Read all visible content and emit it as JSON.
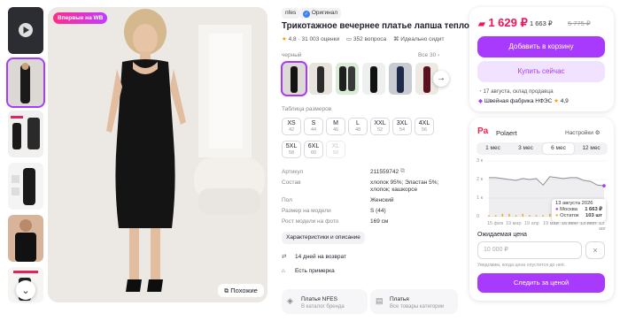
{
  "gallery": {
    "badge": "Впервые на WB",
    "similar_label": "Похожие"
  },
  "product": {
    "brand": "nfes",
    "original_label": "Оригинал",
    "title": "Трикотажное вечернее платье лапша теплое",
    "rating": "4,8",
    "reviews": "31 003 оценки",
    "questions": "352 вопроса",
    "fit_label": "Идеально сидит",
    "color_label": "черный",
    "colors_all": "Все 30",
    "size_table_label": "Таблица размеров",
    "sizes": [
      {
        "s": "XS",
        "n": "42",
        "disabled": false
      },
      {
        "s": "S",
        "n": "44",
        "disabled": false
      },
      {
        "s": "M",
        "n": "46",
        "disabled": false
      },
      {
        "s": "L",
        "n": "48",
        "disabled": false
      },
      {
        "s": "XXL",
        "n": "52",
        "disabled": false
      },
      {
        "s": "3XL",
        "n": "54",
        "disabled": false
      },
      {
        "s": "4XL",
        "n": "56",
        "disabled": false
      },
      {
        "s": "5XL",
        "n": "58",
        "disabled": false
      },
      {
        "s": "6XL",
        "n": "60",
        "disabled": false
      },
      {
        "s": "XL",
        "n": "50",
        "disabled": true
      }
    ],
    "specs": [
      {
        "k": "Артикул",
        "v": "211559742"
      },
      {
        "k": "Состав",
        "v": "хлопок 95%; Эластан 5%;"
      },
      {
        "k": "",
        "v": "хлопок; кашкорсе"
      },
      {
        "k": "Пол",
        "v": "Женский"
      },
      {
        "k": "Размер на модели",
        "v": "S (44)"
      },
      {
        "k": "Рост модели на фото",
        "v": "169 см"
      }
    ],
    "description_button": "Характеристики и описание",
    "services": [
      {
        "icon": "return-icon",
        "label": "14 дней на возврат"
      },
      {
        "icon": "hanger-icon",
        "label": "Есть примерка"
      }
    ],
    "footer_cards": [
      {
        "title": "Платья NFES",
        "subtitle": "В каталог бренда"
      },
      {
        "title": "Платья",
        "subtitle": "Все товары категории"
      }
    ]
  },
  "buy": {
    "price": "1 629 ₽",
    "price_wallet": "1 663 ₽",
    "price_old": "5 775 ₽",
    "cart_button": "Добавить в корзину",
    "buy_button": "Купить сейчас",
    "delivery": "17 августа, склад продавца",
    "seller": "Швейная фабрика НФЭС",
    "seller_rating": "4,9",
    "accent": "#a73afd",
    "price_color": "#f91155"
  },
  "polaert": {
    "logo": "Pa",
    "name": "Polaert",
    "settings": "Настройки",
    "tabs": [
      "1 мес",
      "3 мес",
      "6 мес",
      "12 мес"
    ],
    "active_tab": 2,
    "tooltip": {
      "date": "13 августа 2026",
      "rows": [
        {
          "k": "Москва",
          "v": "1 663 ₽"
        },
        {
          "k": "Остаток",
          "v": "103 шт"
        }
      ]
    },
    "expected_label": "Ожидаемая цена",
    "expected_placeholder": "10 000 ₽",
    "note": "Уведомим, когда цена опустится до неё.",
    "follow_button": "Следить за ценой"
  },
  "chart_data": {
    "type": "line",
    "y_ticks": [
      "3 к",
      "2 к",
      "1 к",
      "0"
    ],
    "x_ticks": [
      "15 фев",
      "19 мар",
      "19 апр",
      "19 май",
      "16 июн",
      "13 июл",
      "13 авг"
    ],
    "ylim": [
      0,
      3000
    ],
    "series": [
      {
        "values": [
          2100,
          2100,
          2050,
          2000,
          1950,
          2050,
          2000,
          2050,
          1700,
          2150,
          2100,
          2050,
          2100,
          2100,
          1950,
          1900,
          1700,
          1663
        ]
      }
    ],
    "stock_bars": [
      1,
      1,
      2,
      2,
      1,
      2,
      1,
      1,
      1,
      2,
      2,
      1,
      2,
      1,
      1,
      2,
      5,
      7
    ]
  }
}
